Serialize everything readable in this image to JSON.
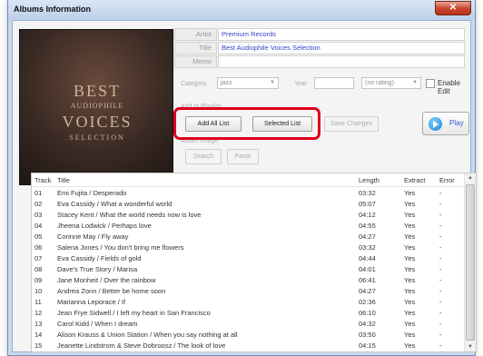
{
  "window": {
    "title": "Albums Information",
    "close_glyph": "✕"
  },
  "cover": {
    "line1": "BEST",
    "line2": "AUDIOPHILE",
    "line3": "VOICES",
    "line4": "SELECTION"
  },
  "info": {
    "artist_label": "Artist",
    "artist_value": "Premium Records",
    "title_label": "Title",
    "title_value": "Best Audiophile Voices Selection",
    "memo_label": "Memo",
    "memo_value": ""
  },
  "meta": {
    "category_label": "Category",
    "category_value": "jazz",
    "year_label": "Year",
    "year_value": "",
    "rating_value": "(no rating)",
    "enable_edit_label": "Enable Edit",
    "enable_edit_checked": false
  },
  "playlist": {
    "label": "Add to Playlist",
    "add_all": "Add All List",
    "selected": "Selected List",
    "save_changes": "Save Changes"
  },
  "album_image": {
    "label": "Album Image",
    "search": "Search",
    "paste": "Paste"
  },
  "play": {
    "label": "Play"
  },
  "tracks": {
    "headers": {
      "track": "Track",
      "title": "Title",
      "length": "Length",
      "extract": "Extract",
      "error": "Error"
    },
    "rows": [
      {
        "track": "01",
        "title": "Emi Fujita / Desperado",
        "length": "03:32",
        "extract": "Yes",
        "error": "-"
      },
      {
        "track": "02",
        "title": "Eva Cassidy / What a wonderful world",
        "length": "05:07",
        "extract": "Yes",
        "error": "-"
      },
      {
        "track": "03",
        "title": "Stacey Kent / What the world needs now is love",
        "length": "04:12",
        "extract": "Yes",
        "error": "-"
      },
      {
        "track": "04",
        "title": "Jheena Lodwick / Perhaps love",
        "length": "04:55",
        "extract": "Yes",
        "error": "-"
      },
      {
        "track": "05",
        "title": "Corinne May / Fly away",
        "length": "04:27",
        "extract": "Yes",
        "error": "-"
      },
      {
        "track": "06",
        "title": "Salena Jones / You don't bring me flowers",
        "length": "03:32",
        "extract": "Yes",
        "error": "-"
      },
      {
        "track": "07",
        "title": "Eva Cassidy / Fields of gold",
        "length": "04:44",
        "extract": "Yes",
        "error": "-"
      },
      {
        "track": "08",
        "title": "Dave's True Story / Marisa",
        "length": "04:01",
        "extract": "Yes",
        "error": "-"
      },
      {
        "track": "09",
        "title": "Jane Monheit / Over the rainbow",
        "length": "06:41",
        "extract": "Yes",
        "error": "-"
      },
      {
        "track": "10",
        "title": "Andrea Zonn / Better be home soon",
        "length": "04:27",
        "extract": "Yes",
        "error": "-"
      },
      {
        "track": "11",
        "title": "Marianna Leporace / If",
        "length": "02:36",
        "extract": "Yes",
        "error": "-"
      },
      {
        "track": "12",
        "title": "Jean Frye Sidwell / I left my heart in San Francisco",
        "length": "06:10",
        "extract": "Yes",
        "error": "-"
      },
      {
        "track": "13",
        "title": "Carol Kidd / When I dream",
        "length": "04:32",
        "extract": "Yes",
        "error": "-"
      },
      {
        "track": "14",
        "title": "Alison Krauss & Union Station / When you say nothing at all",
        "length": "03:50",
        "extract": "Yes",
        "error": "-"
      },
      {
        "track": "15",
        "title": "Jeanette Lindstrom & Steve Dobroosz / The look of love",
        "length": "04:15",
        "extract": "Yes",
        "error": "-"
      }
    ]
  },
  "colors": {
    "highlight": "#e0001a",
    "link_blue": "#3344cc",
    "close_red": "#c8442a"
  }
}
